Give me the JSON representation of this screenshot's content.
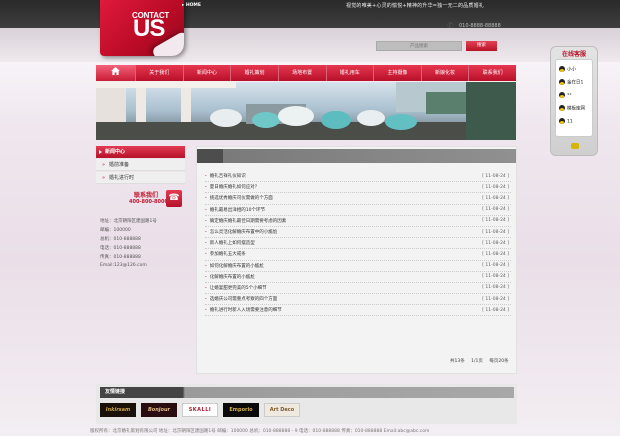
{
  "header": {
    "logo_small": "CONTACT",
    "logo_big": "US",
    "home_link": "HOME",
    "slogan": "视觉的唯美+心灵的愉悦+精神的升华=独一无二的品质婚礼",
    "hotline": "010-8888-88888",
    "search_placeholder": "产品搜索",
    "search_button": "搜索"
  },
  "nav": {
    "items": [
      "关于我们",
      "新闻中心",
      "婚礼策划",
      "场地布置",
      "婚礼用车",
      "主持摄像",
      "新娘化妆",
      "联系我们"
    ]
  },
  "sidebar": {
    "title": "新闻中心",
    "items": [
      "婚前准备",
      "婚礼进行时"
    ],
    "contact_title": "联系我们",
    "contact_phone": "400-800-8000",
    "address": [
      "地址：北京朝阳区建国路1号",
      "邮编：100000",
      "总机：010-888888",
      "电话：010-888888",
      "传真：010-888888",
      "Email:123@126.com"
    ]
  },
  "news": {
    "rows": [
      {
        "title": "婚礼吉祥礼仪知识",
        "date": "[ 11-08-24 ]"
      },
      {
        "title": "夏日婚庆婚礼如何应对？",
        "date": "[ 11-08-24 ]"
      },
      {
        "title": "挑选优秀婚庆司仪需做的个方面",
        "date": "[ 11-08-24 ]"
      },
      {
        "title": "婚礼最易出洋相的10个环节",
        "date": "[ 11-08-24 ]"
      },
      {
        "title": "确定婚庆婚礼最佳日期需要考虑的因素",
        "date": "[ 11-08-24 ]"
      },
      {
        "title": "怎么灵活化解婚庆布置中的小尴尬",
        "date": "[ 11-08-24 ]"
      },
      {
        "title": "新人婚礼上如何摆造型",
        "date": "[ 11-08-24 ]"
      },
      {
        "title": "参加婚礼五大戒条",
        "date": "[ 11-08-24 ]"
      },
      {
        "title": "如何化解婚庆布置的小尴尬",
        "date": "[ 11-08-24 ]"
      },
      {
        "title": "化解婚庆布置的小尴尬",
        "date": "[ 11-08-24 ]"
      },
      {
        "title": "让婚宴甜更完美的5个小细节",
        "date": "[ 11-08-24 ]"
      },
      {
        "title": "选婚庆公司需重点考察的四个方面",
        "date": "[ 11-08-24 ]"
      },
      {
        "title": "婚礼进行时新人入场需要注意的细节",
        "date": "[ 11-08-24 ]"
      }
    ],
    "pager": {
      "total": "共13条",
      "pages": "1/1页",
      "per_page": "每页20条"
    }
  },
  "friend_links": {
    "title": "友情链接",
    "logos": [
      "Inkirsam",
      "Bonjour",
      "SKALLI",
      "Emporio",
      "Art Deco"
    ]
  },
  "footer": {
    "text": "版权所有：北京婚礼策划有限公司 地址：北京朝阳区建国路1号 邮编：100000  总机：010-888888 - 9 电话：010-888888 传真：010-888888 Email:abc@abc.com"
  },
  "online": {
    "title": "在线客服",
    "contacts": [
      "小小",
      "金在日1",
      "**",
      "模板库网",
      "11"
    ]
  },
  "colors": {
    "accent": "#c3142b",
    "nav": "#d72240",
    "dark": "#3a3a3a"
  }
}
